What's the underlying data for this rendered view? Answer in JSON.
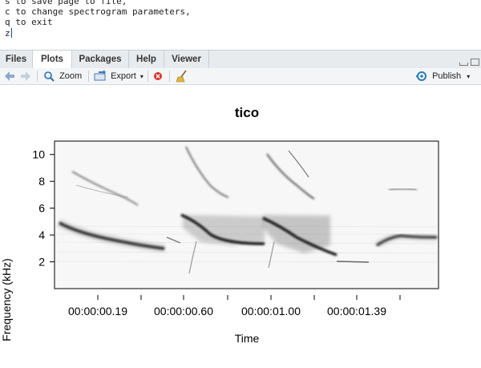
{
  "console": {
    "line1": "s to save page to file,",
    "line2": "c to change spectrogram parameters,",
    "line3": "q to exit",
    "prompt": "z"
  },
  "tabs": [
    "Files",
    "Plots",
    "Packages",
    "Help",
    "Viewer"
  ],
  "active_tab": "Plots",
  "toolbar": {
    "zoom_label": "Zoom",
    "export_label": "Export",
    "publish_label": "Publish"
  },
  "colors": {
    "accent": "#2a7ab8",
    "tab_bar": "#e8ebee"
  },
  "chart_data": {
    "type": "heatmap",
    "title": "tico",
    "xlabel": "Time",
    "ylabel": "Frequency (kHz)",
    "y_ticks": [
      "2",
      "4",
      "6",
      "8",
      "10"
    ],
    "x_tick_labels": [
      "00:00:00.19",
      "00:00:00.60",
      "00:00:01.00",
      "00:00:01.39"
    ],
    "ylim": [
      0,
      11
    ],
    "colormap": "grayscale (white = low, black = high)"
  }
}
